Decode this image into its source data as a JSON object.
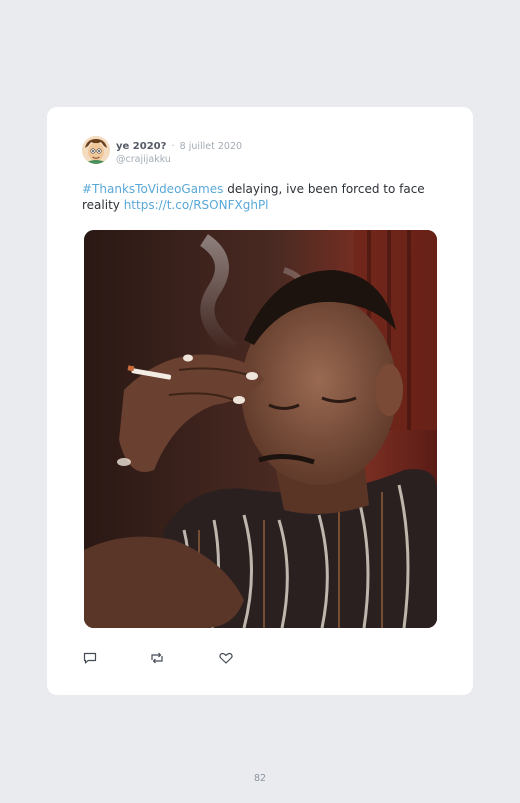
{
  "tweet": {
    "display_name": "ye 2020?",
    "separator": "·",
    "date": "8 juillet 2020",
    "handle": "@crajijakku",
    "hashtag": "#ThanksToVideoGames",
    "body": " delaying, ive been forced to face reality ",
    "link": "https://t.co/RSONFXghPl",
    "media_description_icon": "photo-man-smoking",
    "actions": [
      {
        "name": "reply",
        "icon": "speech-bubble-icon"
      },
      {
        "name": "retweet",
        "icon": "retweet-icon"
      },
      {
        "name": "like",
        "icon": "heart-icon"
      }
    ]
  },
  "page": {
    "number": "82"
  },
  "colors": {
    "background": "#e9ebef",
    "card": "#ffffff",
    "link": "#5aa8d8",
    "muted": "#a4acb6"
  }
}
